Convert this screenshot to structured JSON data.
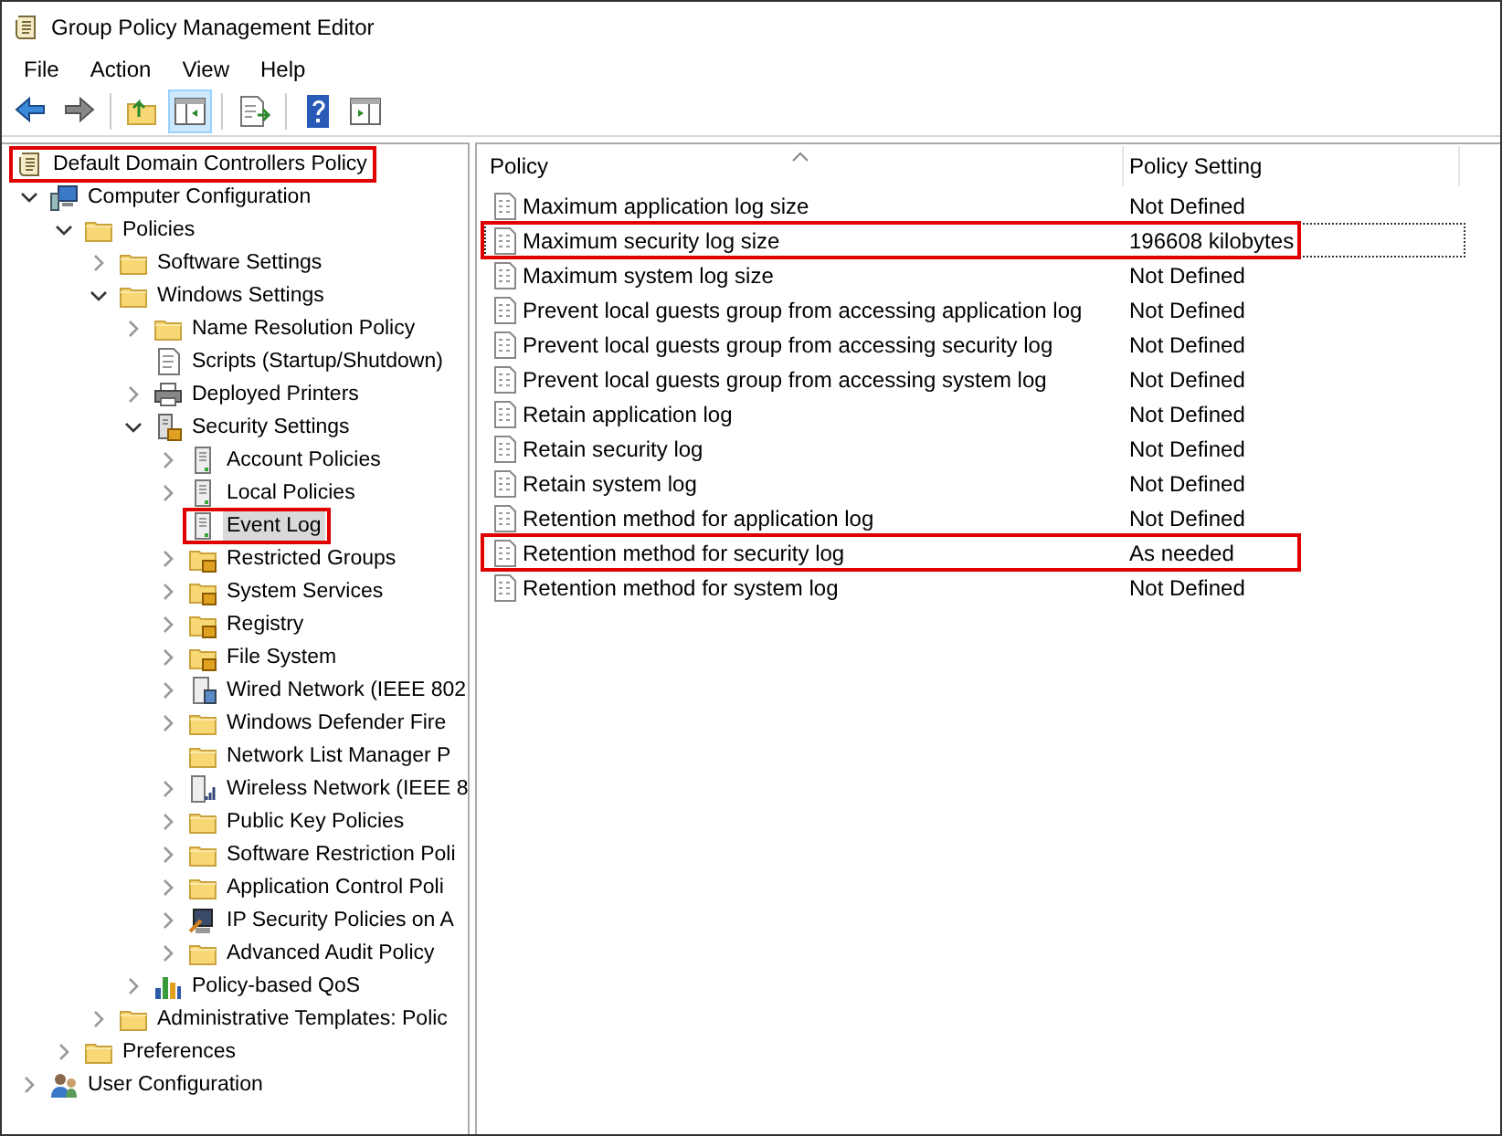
{
  "window": {
    "title": "Group Policy Management Editor"
  },
  "menu": [
    "File",
    "Action",
    "View",
    "Help"
  ],
  "toolbar": [
    {
      "kind": "back",
      "pressed": false
    },
    {
      "kind": "forward",
      "pressed": false
    },
    {
      "kind": "separator"
    },
    {
      "kind": "up",
      "pressed": false
    },
    {
      "kind": "tree-pane",
      "pressed": true
    },
    {
      "kind": "separator"
    },
    {
      "kind": "export",
      "pressed": false
    },
    {
      "kind": "separator"
    },
    {
      "kind": "help",
      "pressed": false
    },
    {
      "kind": "action-pane",
      "pressed": false
    }
  ],
  "tree": {
    "label": "Default Domain Controllers Policy",
    "kind": "scroll",
    "selected": false,
    "highlighted": true,
    "children": [
      {
        "label": "Computer Configuration",
        "kind": "computer",
        "expandable": true,
        "expanded": true,
        "selected": false,
        "highlighted": false,
        "children": [
          {
            "label": "Policies",
            "kind": "folder",
            "expandable": true,
            "expanded": true,
            "selected": false,
            "highlighted": false,
            "children": [
              {
                "label": "Software Settings",
                "kind": "folder",
                "expandable": true,
                "expanded": false,
                "selected": false,
                "highlighted": false
              },
              {
                "label": "Windows Settings",
                "kind": "folder",
                "expandable": true,
                "expanded": true,
                "selected": false,
                "highlighted": false,
                "children": [
                  {
                    "label": "Name Resolution Policy",
                    "kind": "folder",
                    "expandable": true,
                    "expanded": false,
                    "selected": false,
                    "highlighted": false
                  },
                  {
                    "label": "Scripts (Startup/Shutdown)",
                    "kind": "scripts",
                    "expandable": false,
                    "selected": false,
                    "highlighted": false
                  },
                  {
                    "label": "Deployed Printers",
                    "kind": "printer",
                    "expandable": true,
                    "expanded": false,
                    "selected": false,
                    "highlighted": false
                  },
                  {
                    "label": "Security Settings",
                    "kind": "server-lock",
                    "expandable": true,
                    "expanded": true,
                    "selected": false,
                    "highlighted": false,
                    "children": [
                      {
                        "label": "Account Policies",
                        "kind": "server",
                        "expandable": true,
                        "expanded": false,
                        "selected": false,
                        "highlighted": false
                      },
                      {
                        "label": "Local Policies",
                        "kind": "server",
                        "expandable": true,
                        "expanded": false,
                        "selected": false,
                        "highlighted": false
                      },
                      {
                        "label": "Event Log",
                        "kind": "server",
                        "expandable": false,
                        "selected": true,
                        "highlighted": true
                      },
                      {
                        "label": "Restricted Groups",
                        "kind": "folder-lock",
                        "expandable": true,
                        "expanded": false,
                        "selected": false,
                        "highlighted": false
                      },
                      {
                        "label": "System Services",
                        "kind": "folder-lock",
                        "expandable": true,
                        "expanded": false,
                        "selected": false,
                        "highlighted": false
                      },
                      {
                        "label": "Registry",
                        "kind": "folder-lock",
                        "expandable": true,
                        "expanded": false,
                        "selected": false,
                        "highlighted": false
                      },
                      {
                        "label": "File System",
                        "kind": "folder-lock",
                        "expandable": true,
                        "expanded": false,
                        "selected": false,
                        "highlighted": false
                      },
                      {
                        "label": "Wired Network (IEEE 802",
                        "kind": "wired",
                        "expandable": true,
                        "expanded": false,
                        "selected": false,
                        "highlighted": false
                      },
                      {
                        "label": "Windows Defender Fire",
                        "kind": "folder",
                        "expandable": true,
                        "expanded": false,
                        "selected": false,
                        "highlighted": false
                      },
                      {
                        "label": "Network List Manager P",
                        "kind": "folder",
                        "expandable": false,
                        "selected": false,
                        "highlighted": false
                      },
                      {
                        "label": "Wireless Network (IEEE 8",
                        "kind": "wireless",
                        "expandable": true,
                        "expanded": false,
                        "selected": false,
                        "highlighted": false
                      },
                      {
                        "label": "Public Key Policies",
                        "kind": "folder",
                        "expandable": true,
                        "expanded": false,
                        "selected": false,
                        "highlighted": false
                      },
                      {
                        "label": "Software Restriction Poli",
                        "kind": "folder",
                        "expandable": true,
                        "expanded": false,
                        "selected": false,
                        "highlighted": false
                      },
                      {
                        "label": "Application Control Poli",
                        "kind": "folder",
                        "expandable": true,
                        "expanded": false,
                        "selected": false,
                        "highlighted": false
                      },
                      {
                        "label": "IP Security Policies on A",
                        "kind": "ipsec",
                        "expandable": true,
                        "expanded": false,
                        "selected": false,
                        "highlighted": false
                      },
                      {
                        "label": "Advanced Audit Policy",
                        "kind": "folder",
                        "expandable": true,
                        "expanded": false,
                        "selected": false,
                        "highlighted": false
                      }
                    ]
                  },
                  {
                    "label": "Policy-based QoS",
                    "kind": "qos",
                    "expandable": true,
                    "expanded": false,
                    "selected": false,
                    "highlighted": false
                  }
                ]
              },
              {
                "label": "Administrative Templates: Polic",
                "kind": "folder",
                "expandable": true,
                "expanded": false,
                "selected": false,
                "highlighted": false
              }
            ]
          },
          {
            "label": "Preferences",
            "kind": "folder",
            "expandable": true,
            "expanded": false,
            "selected": false,
            "highlighted": false
          }
        ]
      },
      {
        "label": "User Configuration",
        "kind": "user",
        "expandable": true,
        "expanded": false,
        "selected": false,
        "highlighted": false
      }
    ]
  },
  "table": {
    "columns": [
      {
        "label": "Policy",
        "sorted": true
      },
      {
        "label": "Policy Setting",
        "sorted": false
      }
    ],
    "rows": [
      {
        "policy": "Maximum application log size",
        "setting": "Not Defined",
        "focused": false,
        "highlighted": false
      },
      {
        "policy": "Maximum security log size",
        "setting": "196608 kilobytes",
        "focused": true,
        "highlighted": true
      },
      {
        "policy": "Maximum system log size",
        "setting": "Not Defined",
        "focused": false,
        "highlighted": false
      },
      {
        "policy": "Prevent local guests group from accessing application log",
        "setting": "Not Defined",
        "focused": false,
        "highlighted": false
      },
      {
        "policy": "Prevent local guests group from accessing security log",
        "setting": "Not Defined",
        "focused": false,
        "highlighted": false
      },
      {
        "policy": "Prevent local guests group from accessing system log",
        "setting": "Not Defined",
        "focused": false,
        "highlighted": false
      },
      {
        "policy": "Retain application log",
        "setting": "Not Defined",
        "focused": false,
        "highlighted": false
      },
      {
        "policy": "Retain security log",
        "setting": "Not Defined",
        "focused": false,
        "highlighted": false
      },
      {
        "policy": "Retain system log",
        "setting": "Not Defined",
        "focused": false,
        "highlighted": false
      },
      {
        "policy": "Retention method for application log",
        "setting": "Not Defined",
        "focused": false,
        "highlighted": false
      },
      {
        "policy": "Retention method for security log",
        "setting": "As needed",
        "focused": false,
        "highlighted": true
      },
      {
        "policy": "Retention method for system log",
        "setting": "Not Defined",
        "focused": false,
        "highlighted": false
      }
    ]
  }
}
